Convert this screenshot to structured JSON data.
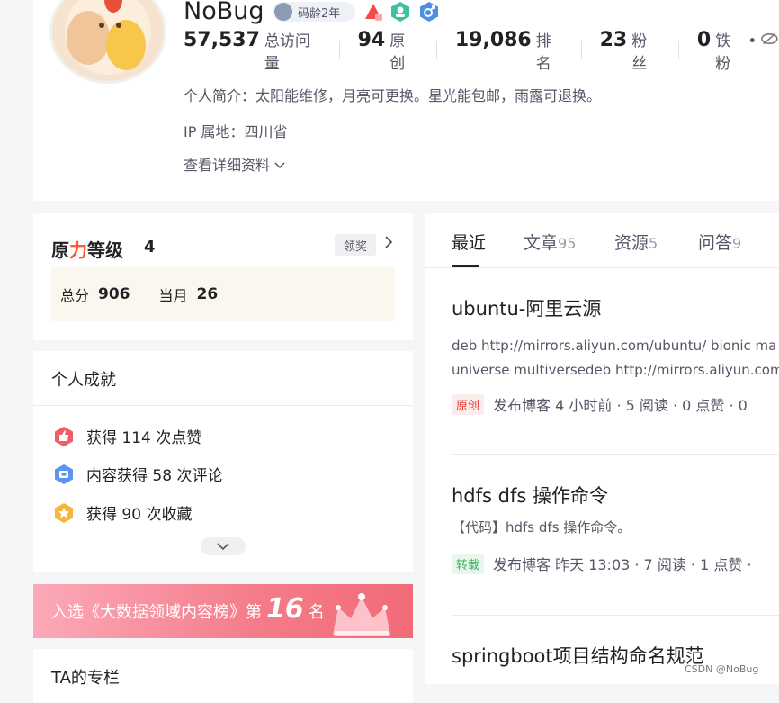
{
  "profile": {
    "username": "NoBug",
    "code_age_badge": "码龄2年",
    "stats": [
      {
        "num": "57,537",
        "label": "总访问量"
      },
      {
        "num": "94",
        "label": "原创"
      },
      {
        "num": "19,086",
        "label": "排名"
      },
      {
        "num": "23",
        "label": "粉丝"
      },
      {
        "num": "0",
        "label": "铁粉"
      }
    ],
    "bio": "个人简介：太阳能维修，月亮可更换。星光能包邮，雨露可退换。",
    "ip": "IP 属地：四川省",
    "more_link": "查看详细资料"
  },
  "level": {
    "title_a": "原",
    "title_b": "力",
    "title_c": "等级",
    "value": "4",
    "award_label": "领奖",
    "total_label": "总分",
    "total_value": "906",
    "month_label": "当月",
    "month_value": "26"
  },
  "achievements": {
    "title": "个人成就",
    "items": [
      {
        "text": "获得 114 次点赞",
        "icon": "thumbs-up-icon",
        "color": "#f05d67"
      },
      {
        "text": "内容获得 58 次评论",
        "icon": "comment-icon",
        "color": "#5b95f0"
      },
      {
        "text": "获得 90 次收藏",
        "icon": "star-icon",
        "color": "#f6b63e"
      }
    ]
  },
  "rank_banner": {
    "prefix": "入选《大数据领域内容榜》第",
    "rank": "16",
    "suffix": "名"
  },
  "column": {
    "title": "TA的专栏"
  },
  "tabs": [
    {
      "label": "最近",
      "count": ""
    },
    {
      "label": "文章",
      "count": "95"
    },
    {
      "label": "资源",
      "count": "5"
    },
    {
      "label": "问答",
      "count": "9"
    }
  ],
  "articles": [
    {
      "title": "ubuntu-阿里云源",
      "desc_lines": [
        "deb http://mirrors.aliyun.com/ubuntu/ bionic ma",
        "universe multiversedeb http://mirrors.aliyun.com"
      ],
      "tag": "原创",
      "meta": "发布博客 4 小时前 ·  5 阅读 ·  0 点赞 ·  0"
    },
    {
      "title": "hdfs dfs 操作命令",
      "desc_lines": [
        "【代码】hdfs dfs 操作命令。"
      ],
      "tag": "转载",
      "meta": "发布博客 昨天 13:03 ·  7 阅读 ·  1 点赞 ·"
    },
    {
      "title": "springboot项目结构命名规范",
      "desc_lines": [],
      "tag": "",
      "meta": ""
    }
  ],
  "watermark": "CSDN @NoBug",
  "colors": {
    "accent_red": "#fc5531",
    "orig_tag": "#e33e33",
    "repost_tag": "#3cb05c"
  }
}
